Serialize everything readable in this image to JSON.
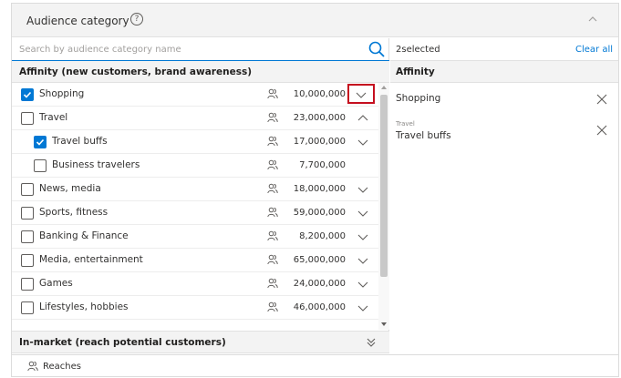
{
  "header": {
    "title": "Audience category",
    "help_glyph": "?"
  },
  "search": {
    "placeholder": "Search by audience category name",
    "value": ""
  },
  "affinity_section": {
    "label": "Affinity (new customers, brand awareness)"
  },
  "rows": [
    {
      "name": "Shopping",
      "count": "10,000,000",
      "checked": true,
      "indent": 0,
      "chevron": "down-boxed"
    },
    {
      "name": "Travel",
      "count": "23,000,000",
      "checked": false,
      "indent": 0,
      "chevron": "up"
    },
    {
      "name": "Travel buffs",
      "count": "17,000,000",
      "checked": true,
      "indent": 1,
      "chevron": "down"
    },
    {
      "name": "Business travelers",
      "count": "7,700,000",
      "checked": false,
      "indent": 1,
      "chevron": "none"
    },
    {
      "name": "News, media",
      "count": "18,000,000",
      "checked": false,
      "indent": 0,
      "chevron": "down"
    },
    {
      "name": "Sports, fitness",
      "count": "59,000,000",
      "checked": false,
      "indent": 0,
      "chevron": "down"
    },
    {
      "name": "Banking & Finance",
      "count": "8,200,000",
      "checked": false,
      "indent": 0,
      "chevron": "down"
    },
    {
      "name": "Media, entertainment",
      "count": "65,000,000",
      "checked": false,
      "indent": 0,
      "chevron": "down"
    },
    {
      "name": "Games",
      "count": "24,000,000",
      "checked": false,
      "indent": 0,
      "chevron": "down"
    },
    {
      "name": "Lifestyles, hobbies",
      "count": "46,000,000",
      "checked": false,
      "indent": 0,
      "chevron": "down"
    }
  ],
  "inmarket_section": {
    "label": "In-market (reach potential customers)"
  },
  "selected": {
    "count_label": "2selected",
    "clear_label": "Clear all",
    "group_label": "Affinity",
    "items": [
      {
        "parent": "",
        "name": "Shopping"
      },
      {
        "parent": "Travel",
        "name": "Travel buffs"
      }
    ]
  },
  "footer": {
    "label": "Reaches"
  },
  "colors": {
    "accent": "#0078d4",
    "highlight_box": "#c50f1f",
    "section_bg": "#f3f3f3"
  },
  "icons": {
    "help": "question-circle-icon",
    "collapse": "chevron-up-icon",
    "search": "search-icon",
    "people": "people-icon",
    "remove": "close-icon"
  }
}
